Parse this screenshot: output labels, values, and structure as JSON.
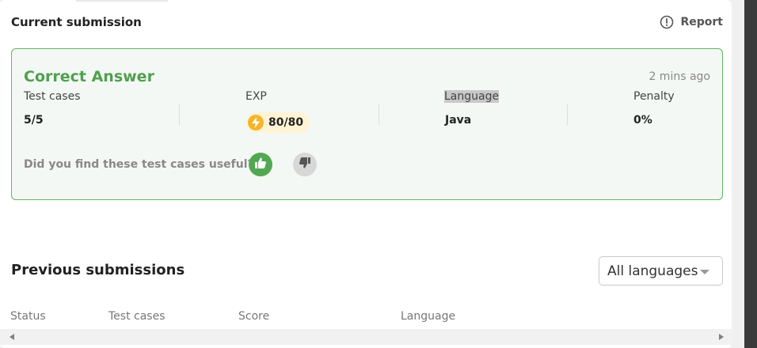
{
  "current": {
    "title": "Current submission",
    "report_label": "Report"
  },
  "result": {
    "status": "Correct Answer",
    "time_ago": "2 mins ago",
    "stats": {
      "test_cases_label": "Test cases",
      "test_cases_value": "5/5",
      "exp_label": "EXP",
      "exp_value": "80/80",
      "language_label": "Language",
      "language_value": "Java",
      "penalty_label": "Penalty",
      "penalty_value": "0%"
    },
    "feedback_question": "Did you find these test cases useful?"
  },
  "previous": {
    "title": "Previous submissions",
    "language_filter": "All languages",
    "columns": [
      "Status",
      "Test cases",
      "Score",
      "Language"
    ]
  },
  "colors": {
    "success": "#4fa04f",
    "card_border": "#62b462",
    "exp_badge": "#fff3d6",
    "bolt": "#f5b52a"
  },
  "icons": [
    "info-icon",
    "lightning-icon",
    "thumbs-up-icon",
    "thumbs-down-icon",
    "caret-down-icon",
    "scroll-left-arrow",
    "scroll-right-arrow"
  ]
}
